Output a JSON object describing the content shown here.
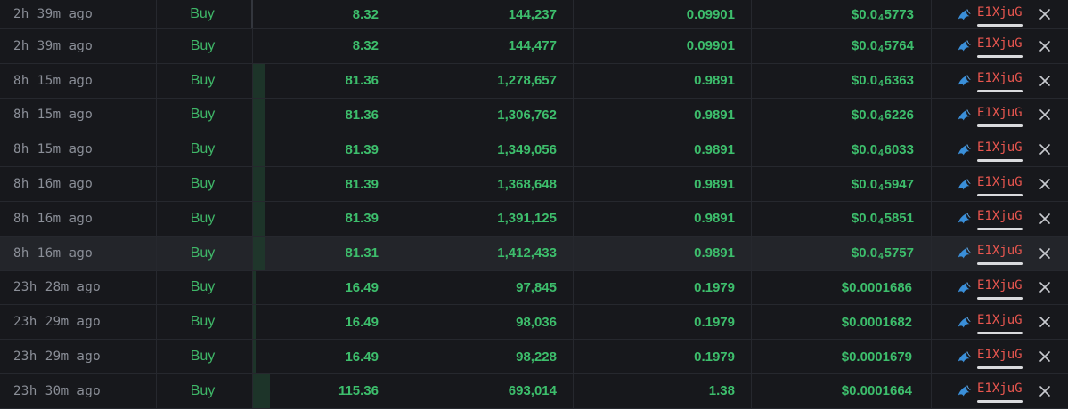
{
  "colors": {
    "buy": "#3fb768",
    "value": "#3dbe6c",
    "maker": "#e8564f",
    "time": "#8b8f98",
    "volume_bar": "#1f3a2b"
  },
  "icons": {
    "maker": "shark-icon",
    "remove": "close-icon"
  },
  "rows": [
    {
      "time": "2h 39m ago",
      "type": "Buy",
      "usd": "8.32",
      "tokens": "144,237",
      "sol": "0.09901",
      "price_prefix": "$0.0",
      "price_sub": "4",
      "price_tail": "5773",
      "maker": "E1XjuG",
      "volume_fill": 0
    },
    {
      "time": "2h 39m ago",
      "type": "Buy",
      "usd": "8.32",
      "tokens": "144,477",
      "sol": "0.09901",
      "price_prefix": "$0.0",
      "price_sub": "4",
      "price_tail": "5764",
      "maker": "E1XjuG",
      "volume_fill": 0
    },
    {
      "time": "8h 15m ago",
      "type": "Buy",
      "usd": "81.36",
      "tokens": "1,278,657",
      "sol": "0.9891",
      "price_prefix": "$0.0",
      "price_sub": "4",
      "price_tail": "6363",
      "maker": "E1XjuG",
      "volume_fill": 0.09
    },
    {
      "time": "8h 15m ago",
      "type": "Buy",
      "usd": "81.36",
      "tokens": "1,306,762",
      "sol": "0.9891",
      "price_prefix": "$0.0",
      "price_sub": "4",
      "price_tail": "6226",
      "maker": "E1XjuG",
      "volume_fill": 0.09
    },
    {
      "time": "8h 15m ago",
      "type": "Buy",
      "usd": "81.39",
      "tokens": "1,349,056",
      "sol": "0.9891",
      "price_prefix": "$0.0",
      "price_sub": "4",
      "price_tail": "6033",
      "maker": "E1XjuG",
      "volume_fill": 0.09
    },
    {
      "time": "8h 16m ago",
      "type": "Buy",
      "usd": "81.39",
      "tokens": "1,368,648",
      "sol": "0.9891",
      "price_prefix": "$0.0",
      "price_sub": "4",
      "price_tail": "5947",
      "maker": "E1XjuG",
      "volume_fill": 0.09
    },
    {
      "time": "8h 16m ago",
      "type": "Buy",
      "usd": "81.39",
      "tokens": "1,391,125",
      "sol": "0.9891",
      "price_prefix": "$0.0",
      "price_sub": "4",
      "price_tail": "5851",
      "maker": "E1XjuG",
      "volume_fill": 0.09
    },
    {
      "time": "8h 16m ago",
      "type": "Buy",
      "usd": "81.31",
      "tokens": "1,412,433",
      "sol": "0.9891",
      "price_prefix": "$0.0",
      "price_sub": "4",
      "price_tail": "5757",
      "maker": "E1XjuG",
      "volume_fill": 0.09,
      "hover": true
    },
    {
      "time": "23h 28m ago",
      "type": "Buy",
      "usd": "16.49",
      "tokens": "97,845",
      "sol": "0.1979",
      "price_prefix": "$0.0001686",
      "price_sub": "",
      "price_tail": "",
      "maker": "E1XjuG",
      "volume_fill": 0.02
    },
    {
      "time": "23h 29m ago",
      "type": "Buy",
      "usd": "16.49",
      "tokens": "98,036",
      "sol": "0.1979",
      "price_prefix": "$0.0001682",
      "price_sub": "",
      "price_tail": "",
      "maker": "E1XjuG",
      "volume_fill": 0.02
    },
    {
      "time": "23h 29m ago",
      "type": "Buy",
      "usd": "16.49",
      "tokens": "98,228",
      "sol": "0.1979",
      "price_prefix": "$0.0001679",
      "price_sub": "",
      "price_tail": "",
      "maker": "E1XjuG",
      "volume_fill": 0.02
    },
    {
      "time": "23h 30m ago",
      "type": "Buy",
      "usd": "115.36",
      "tokens": "693,014",
      "sol": "1.38",
      "price_prefix": "$0.0001664",
      "price_sub": "",
      "price_tail": "",
      "maker": "E1XjuG",
      "volume_fill": 0.12
    }
  ]
}
